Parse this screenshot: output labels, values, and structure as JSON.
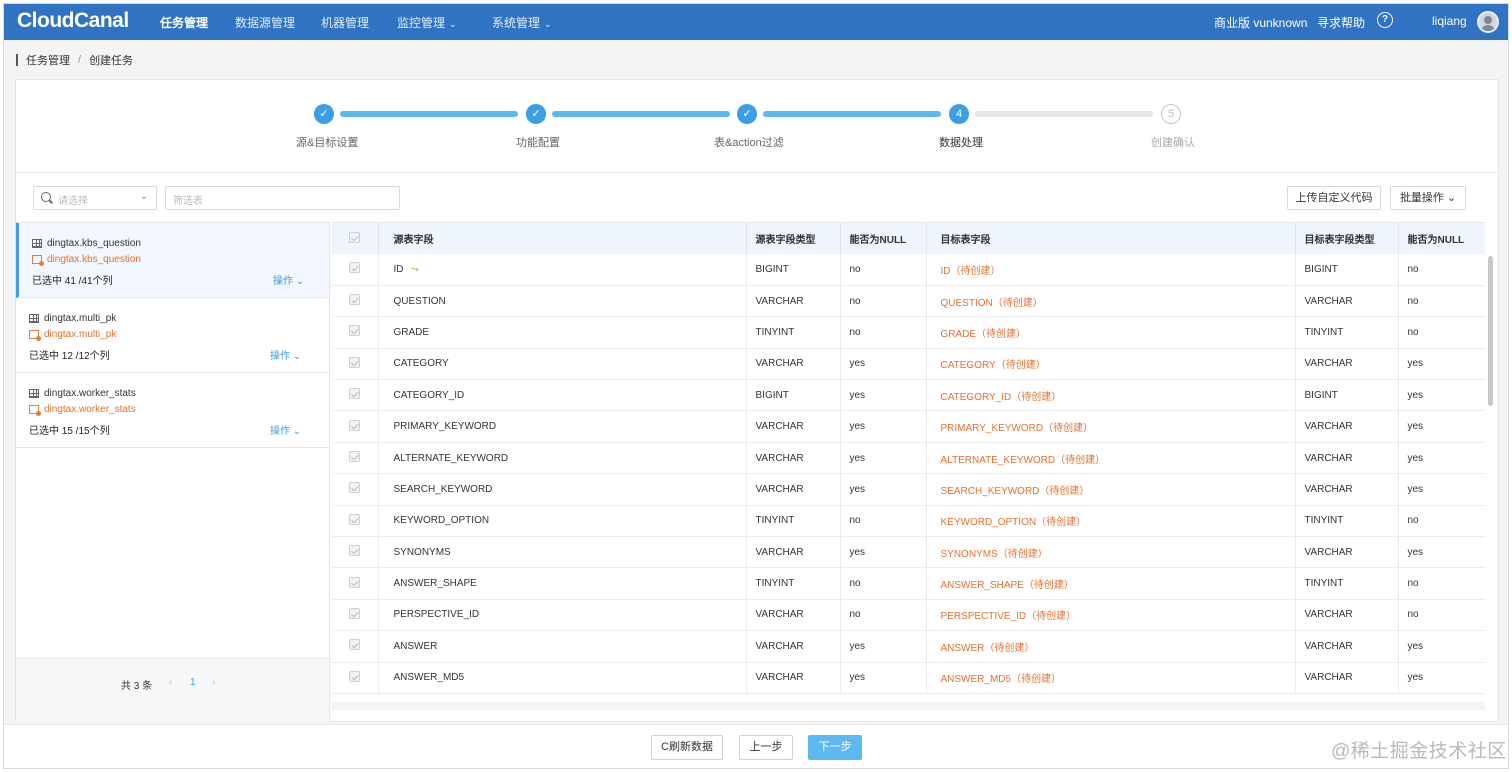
{
  "app": {
    "logo": "CloudCanal",
    "nav": [
      {
        "label": "任务管理",
        "active": true
      },
      {
        "label": "数据源管理"
      },
      {
        "label": "机器管理"
      },
      {
        "label": "监控管理",
        "has_dropdown": true
      },
      {
        "label": "系统管理",
        "has_dropdown": true
      }
    ],
    "edition": "商业版 vunknown",
    "help": "寻求帮助",
    "help_icon": "?",
    "user": "liqiang",
    "chevron": "⌄"
  },
  "breadcrumb": {
    "root": "任务管理",
    "sep": "/",
    "current": "创建任务"
  },
  "steps": [
    {
      "label": "源&目标设置",
      "status": "done",
      "mark": "✓"
    },
    {
      "label": "功能配置",
      "status": "done",
      "mark": "✓"
    },
    {
      "label": "表&action过滤",
      "status": "done",
      "mark": "✓"
    },
    {
      "label": "数据处理",
      "status": "current",
      "mark": "4"
    },
    {
      "label": "创建确认",
      "status": "pending",
      "mark": "5"
    }
  ],
  "filters": {
    "select_placeholder": "请选择",
    "table_filter_placeholder": "筛选表",
    "upload_button": "上传自定义代码",
    "batch_button": "批量操作"
  },
  "tables": [
    {
      "source": "dingtax.kbs_question",
      "target": "dingtax.kbs_question",
      "count": "已选中 41 /41个列",
      "op": "操作",
      "active": true
    },
    {
      "source": "dingtax.multi_pk",
      "target": "dingtax.multi_pk",
      "count": "已选中 12 /12个列",
      "op": "操作"
    },
    {
      "source": "dingtax.worker_stats",
      "target": "dingtax.worker_stats",
      "count": "已选中 15 /15个列",
      "op": "操作"
    }
  ],
  "pagination": {
    "total": "共 3 条",
    "prev": "‹",
    "current": "1",
    "next": "›"
  },
  "columns_table": {
    "headers": [
      "源表字段",
      "源表字段类型",
      "能否为NULL",
      "目标表字段",
      "目标表字段类型",
      "能否为NULL"
    ],
    "rows": [
      {
        "src": "ID",
        "src_type": "BIGINT",
        "src_null": "no",
        "dst": "ID（待创建）",
        "dst_type": "BIGINT",
        "dst_null": "no",
        "key": true
      },
      {
        "src": "QUESTION",
        "src_type": "VARCHAR",
        "src_null": "no",
        "dst": "QUESTION（待创建）",
        "dst_type": "VARCHAR",
        "dst_null": "no"
      },
      {
        "src": "GRADE",
        "src_type": "TINYINT",
        "src_null": "no",
        "dst": "GRADE（待创建）",
        "dst_type": "TINYINT",
        "dst_null": "no"
      },
      {
        "src": "CATEGORY",
        "src_type": "VARCHAR",
        "src_null": "yes",
        "dst": "CATEGORY（待创建）",
        "dst_type": "VARCHAR",
        "dst_null": "yes"
      },
      {
        "src": "CATEGORY_ID",
        "src_type": "BIGINT",
        "src_null": "yes",
        "dst": "CATEGORY_ID（待创建）",
        "dst_type": "BIGINT",
        "dst_null": "yes"
      },
      {
        "src": "PRIMARY_KEYWORD",
        "src_type": "VARCHAR",
        "src_null": "yes",
        "dst": "PRIMARY_KEYWORD（待创建）",
        "dst_type": "VARCHAR",
        "dst_null": "yes"
      },
      {
        "src": "ALTERNATE_KEYWORD",
        "src_type": "VARCHAR",
        "src_null": "yes",
        "dst": "ALTERNATE_KEYWORD（待创建）",
        "dst_type": "VARCHAR",
        "dst_null": "yes"
      },
      {
        "src": "SEARCH_KEYWORD",
        "src_type": "VARCHAR",
        "src_null": "yes",
        "dst": "SEARCH_KEYWORD（待创建）",
        "dst_type": "VARCHAR",
        "dst_null": "yes"
      },
      {
        "src": "KEYWORD_OPTION",
        "src_type": "TINYINT",
        "src_null": "no",
        "dst": "KEYWORD_OPTION（待创建）",
        "dst_type": "TINYINT",
        "dst_null": "no"
      },
      {
        "src": "SYNONYMS",
        "src_type": "VARCHAR",
        "src_null": "yes",
        "dst": "SYNONYMS（待创建）",
        "dst_type": "VARCHAR",
        "dst_null": "yes"
      },
      {
        "src": "ANSWER_SHAPE",
        "src_type": "TINYINT",
        "src_null": "no",
        "dst": "ANSWER_SHAPE（待创建）",
        "dst_type": "TINYINT",
        "dst_null": "no"
      },
      {
        "src": "PERSPECTIVE_ID",
        "src_type": "VARCHAR",
        "src_null": "no",
        "dst": "PERSPECTIVE_ID（待创建）",
        "dst_type": "VARCHAR",
        "dst_null": "no"
      },
      {
        "src": "ANSWER",
        "src_type": "VARCHAR",
        "src_null": "yes",
        "dst": "ANSWER（待创建）",
        "dst_type": "VARCHAR",
        "dst_null": "yes"
      },
      {
        "src": "ANSWER_MD5",
        "src_type": "VARCHAR",
        "src_null": "yes",
        "dst": "ANSWER_MD5（待创建）",
        "dst_type": "VARCHAR",
        "dst_null": "yes"
      }
    ]
  },
  "footer": {
    "refresh": "C刷新数据",
    "prev": "上一步",
    "next": "下一步",
    "watermark": "@稀土掘金技术社区"
  },
  "colors": {
    "nav_bg": "#2f73c2",
    "accent": "#3b9ee6",
    "target_text": "#e6702e"
  }
}
